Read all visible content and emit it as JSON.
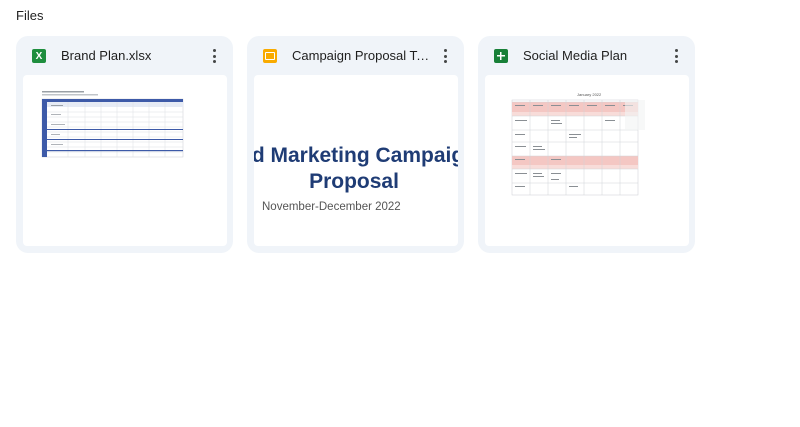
{
  "section": {
    "title": "Files"
  },
  "files": [
    {
      "name": "Brand Plan.xlsx",
      "type_icon": "excel-icon"
    },
    {
      "name": "Campaign Proposal Tem...",
      "type_icon": "slides-icon",
      "preview": {
        "title_line1": "d Marketing Campaig",
        "title_line2": "Proposal",
        "date": "November-December 2022"
      }
    },
    {
      "name": "Social Media Plan",
      "type_icon": "sheets-icon",
      "preview": {
        "heading": "January 2022"
      }
    }
  ],
  "colors": {
    "card_bg": "#f0f4f9",
    "excel": "#1e8e3e",
    "slides": "#f9ab00",
    "sheets": "#188038",
    "slide_title": "#1f3c75",
    "row_highlight": "#f4c7c3"
  }
}
